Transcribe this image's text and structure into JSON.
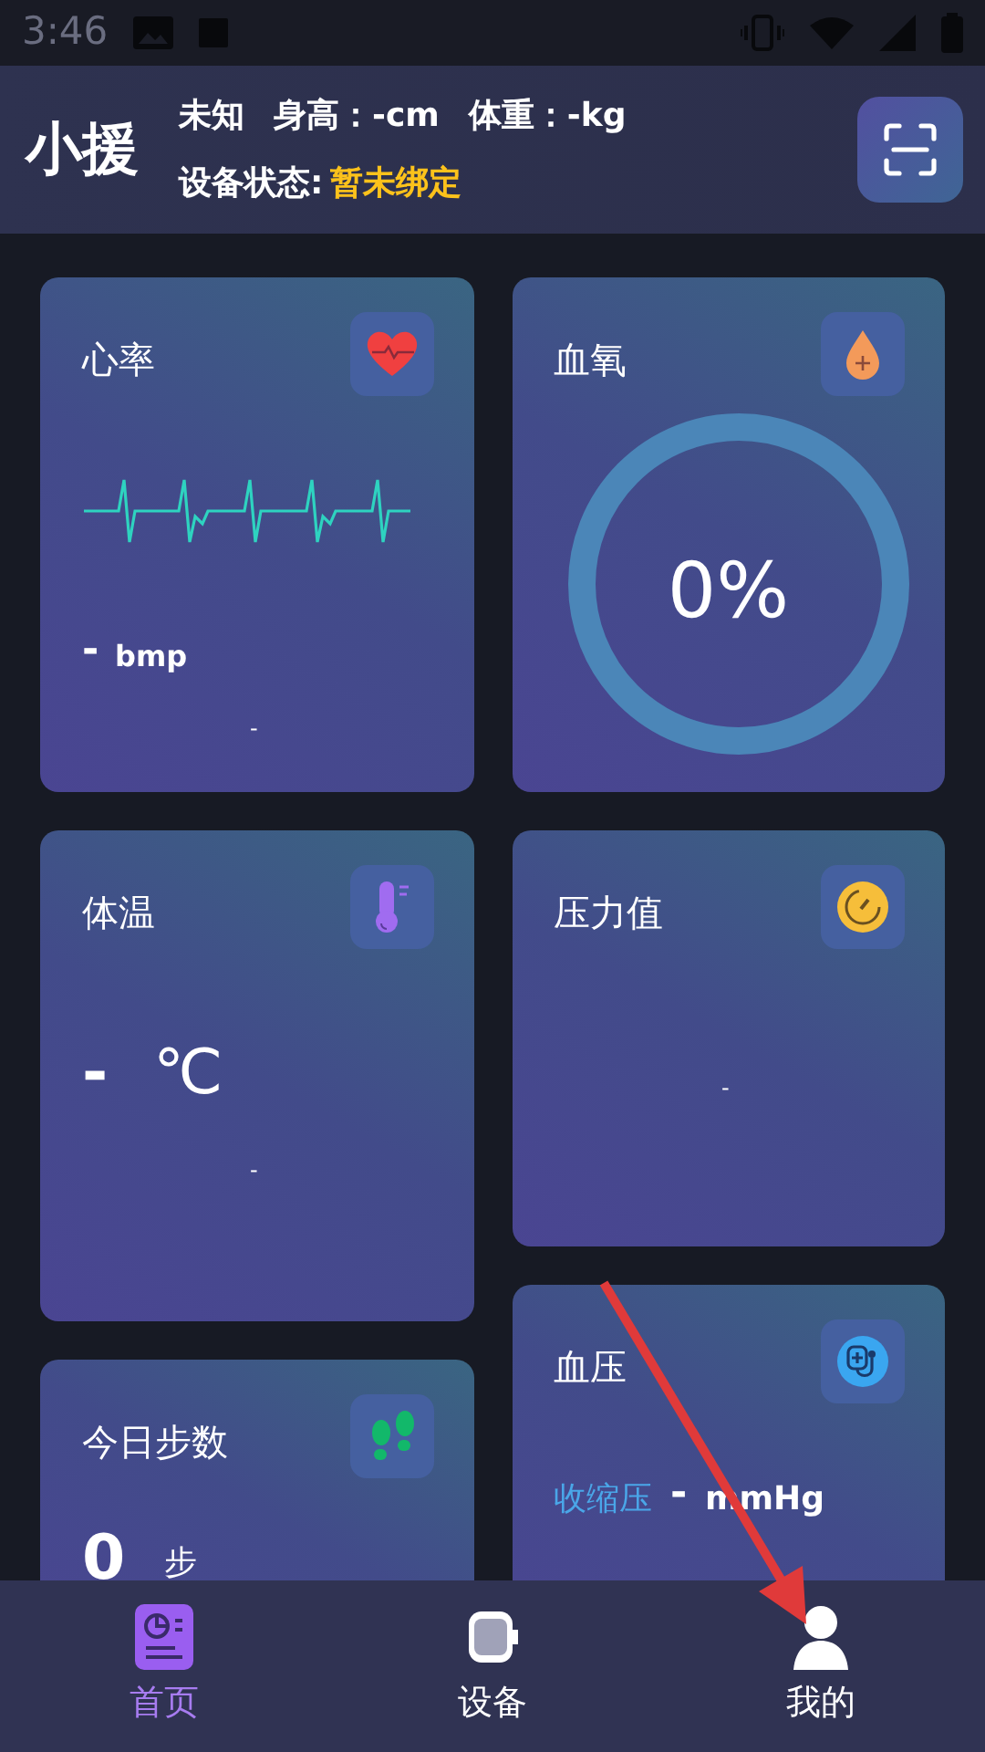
{
  "status_bar": {
    "time": "3:46"
  },
  "header": {
    "logo": "小援",
    "gender": "未知",
    "height": "身高：-cm",
    "weight": "体重：-kg",
    "device_label": "设备状态:",
    "device_status": "暂未绑定"
  },
  "columns": [
    {
      "cards": [
        {
          "kind": "heart",
          "title": "心率",
          "value": "-",
          "unit": "bmp",
          "footer": "-"
        },
        {
          "kind": "temperature",
          "title": "体温",
          "value": "-",
          "unit": "℃",
          "footer": "-"
        },
        {
          "kind": "steps",
          "title": "今日步数",
          "value": "0",
          "unit": "步"
        }
      ]
    },
    {
      "cards": [
        {
          "kind": "oxygen",
          "title": "血氧",
          "value": "0%"
        },
        {
          "kind": "pressure",
          "title": "压力值",
          "footer": "-"
        },
        {
          "kind": "blood_pressure",
          "title": "血压",
          "label": "收缩压",
          "value": "-",
          "unit": "mmHg"
        }
      ]
    }
  ],
  "nav": [
    {
      "label": "首页",
      "selected": true
    },
    {
      "label": "设备",
      "selected": false
    },
    {
      "label": "我的",
      "selected": false
    }
  ]
}
